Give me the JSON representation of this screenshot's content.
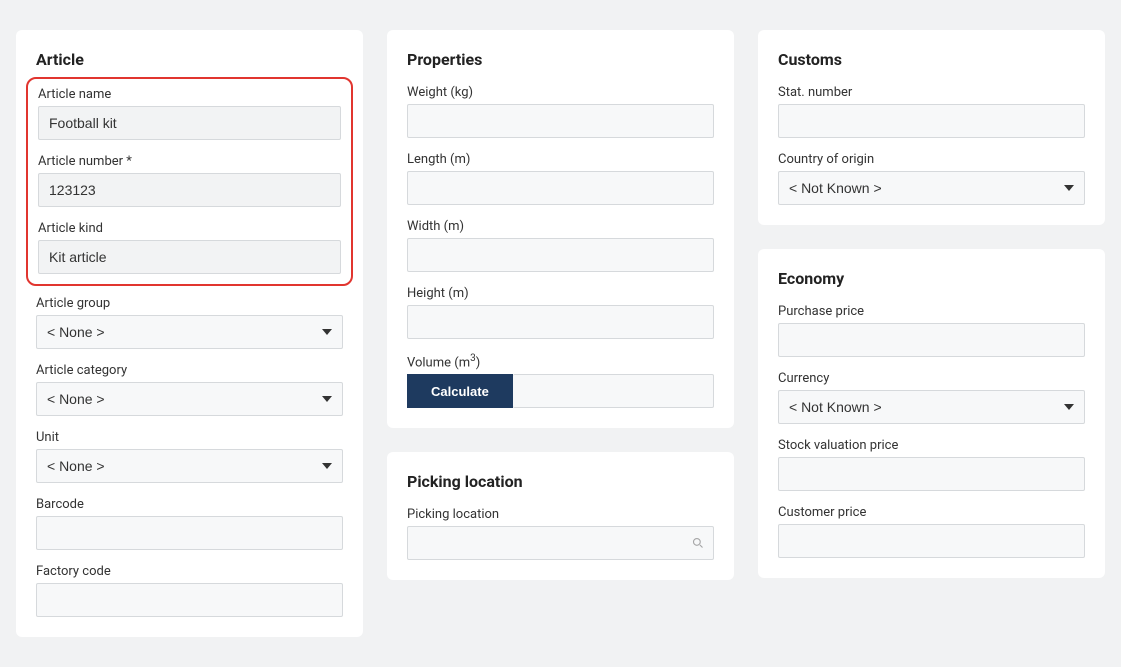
{
  "article": {
    "heading": "Article",
    "name_label": "Article name",
    "name_value": "Football kit",
    "number_label": "Article number *",
    "number_value": "123123",
    "kind_label": "Article kind",
    "kind_value": "Kit article",
    "group_label": "Article group",
    "group_value": "< None >",
    "category_label": "Article category",
    "category_value": "< None >",
    "unit_label": "Unit",
    "unit_value": "< None >",
    "barcode_label": "Barcode",
    "barcode_value": "",
    "factory_label": "Factory code",
    "factory_value": ""
  },
  "properties": {
    "heading": "Properties",
    "weight_label": "Weight (kg)",
    "weight_value": "",
    "length_label": "Length (m)",
    "length_value": "",
    "width_label": "Width (m)",
    "width_value": "",
    "height_label": "Height (m)",
    "height_value": "",
    "volume_label_prefix": "Volume (m",
    "volume_label_suffix": ")",
    "volume_value": "",
    "calculate_label": "Calculate"
  },
  "picking": {
    "heading": "Picking location",
    "location_label": "Picking location",
    "location_value": ""
  },
  "customs": {
    "heading": "Customs",
    "stat_label": "Stat. number",
    "stat_value": "",
    "country_label": "Country of origin",
    "country_value": "< Not Known >"
  },
  "economy": {
    "heading": "Economy",
    "purchase_label": "Purchase price",
    "purchase_value": "",
    "currency_label": "Currency",
    "currency_value": "< Not Known >",
    "stock_label": "Stock valuation price",
    "stock_value": "",
    "customer_label": "Customer price",
    "customer_value": ""
  }
}
